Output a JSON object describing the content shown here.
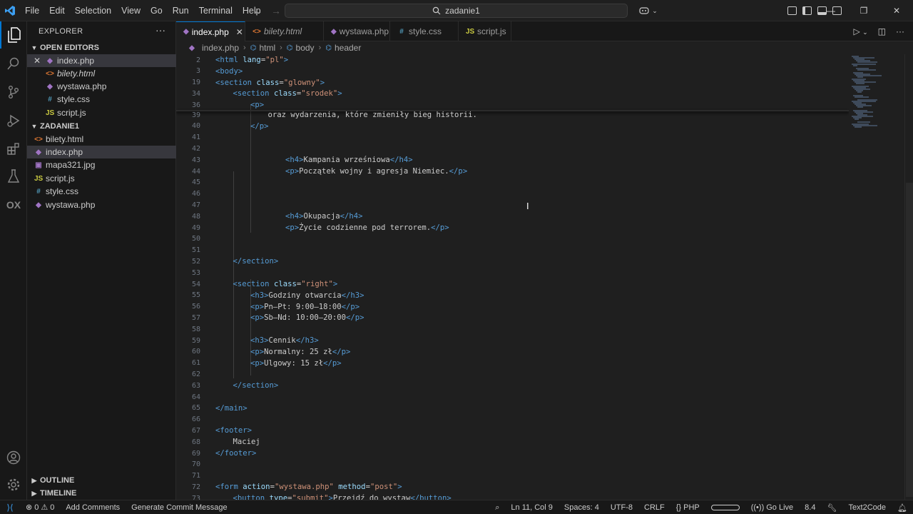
{
  "titlebar": {
    "menu": [
      "File",
      "Edit",
      "Selection",
      "View",
      "Go",
      "Run",
      "Terminal",
      "Help"
    ],
    "search_text": "zadanie1"
  },
  "sidebar": {
    "title": "EXPLORER",
    "open_editors_label": "OPEN EDITORS",
    "open_editors": [
      {
        "name": "index.php",
        "icon": "php-file-icon",
        "italic": false
      },
      {
        "name": "bilety.html",
        "icon": "html-file-icon",
        "italic": true
      },
      {
        "name": "wystawa.php",
        "icon": "php-file-icon",
        "italic": false
      },
      {
        "name": "style.css",
        "icon": "css-file-icon",
        "italic": false
      },
      {
        "name": "script.js",
        "icon": "js-file-icon",
        "italic": false
      }
    ],
    "folder_label": "ZADANIE1",
    "files": [
      {
        "name": "bilety.html",
        "icon": "html-file-icon"
      },
      {
        "name": "index.php",
        "icon": "php-file-icon"
      },
      {
        "name": "mapa321.jpg",
        "icon": "image-file-icon"
      },
      {
        "name": "script.js",
        "icon": "js-file-icon"
      },
      {
        "name": "style.css",
        "icon": "css-file-icon"
      },
      {
        "name": "wystawa.php",
        "icon": "php-file-icon"
      }
    ],
    "outline_label": "OUTLINE",
    "timeline_label": "TIMELINE"
  },
  "tabs": [
    {
      "label": "index.php",
      "icon": "php-file-icon",
      "active": true,
      "italic": false
    },
    {
      "label": "bilety.html",
      "icon": "html-file-icon",
      "active": false,
      "italic": true
    },
    {
      "label": "wystawa.php",
      "icon": "php-file-icon",
      "active": false,
      "italic": false
    },
    {
      "label": "style.css",
      "icon": "css-file-icon",
      "active": false,
      "italic": false
    },
    {
      "label": "script.js",
      "icon": "js-file-icon",
      "active": false,
      "italic": false
    }
  ],
  "breadcrumb": [
    "index.php",
    "html",
    "body",
    "header"
  ],
  "editor": {
    "sticky_lines": [
      {
        "num": "2",
        "indent": 0,
        "tokens": [
          [
            "brk",
            "<"
          ],
          [
            "tag",
            "html"
          ],
          [
            "txt",
            " "
          ],
          [
            "attr",
            "lang"
          ],
          [
            "txt",
            "="
          ],
          [
            "str",
            "\"pl\""
          ],
          [
            "brk",
            ">"
          ]
        ]
      },
      {
        "num": "3",
        "indent": 0,
        "tokens": [
          [
            "brk",
            "<"
          ],
          [
            "tag",
            "body"
          ],
          [
            "brk",
            ">"
          ]
        ]
      },
      {
        "num": "19",
        "indent": 0,
        "tokens": [
          [
            "brk",
            "<"
          ],
          [
            "tag",
            "section"
          ],
          [
            "txt",
            " "
          ],
          [
            "attr",
            "class"
          ],
          [
            "txt",
            "="
          ],
          [
            "str",
            "\"glowny\""
          ],
          [
            "brk",
            ">"
          ]
        ]
      },
      {
        "num": "34",
        "indent": 1,
        "tokens": [
          [
            "brk",
            "<"
          ],
          [
            "tag",
            "section"
          ],
          [
            "txt",
            " "
          ],
          [
            "attr",
            "class"
          ],
          [
            "txt",
            "="
          ],
          [
            "str",
            "\"srodek\""
          ],
          [
            "brk",
            ">"
          ]
        ]
      },
      {
        "num": "36",
        "indent": 2,
        "tokens": [
          [
            "brk",
            "<"
          ],
          [
            "tag",
            "p"
          ],
          [
            "brk",
            ">"
          ]
        ]
      }
    ],
    "lines": [
      {
        "num": "39",
        "indent": 3,
        "tokens": [
          [
            "txt",
            "oraz wydarzenia, które zmieniły bieg historii."
          ]
        ]
      },
      {
        "num": "40",
        "indent": 2,
        "tokens": [
          [
            "brk",
            "</"
          ],
          [
            "tag",
            "p"
          ],
          [
            "brk",
            ">"
          ]
        ]
      },
      {
        "num": "41",
        "indent": 0,
        "tokens": []
      },
      {
        "num": "42",
        "indent": 0,
        "tokens": []
      },
      {
        "num": "43",
        "indent": 4,
        "tokens": [
          [
            "brk",
            "<"
          ],
          [
            "tag",
            "h4"
          ],
          [
            "brk",
            ">"
          ],
          [
            "txt",
            "Kampania wrześniowa"
          ],
          [
            "brk",
            "</"
          ],
          [
            "tag",
            "h4"
          ],
          [
            "brk",
            ">"
          ]
        ]
      },
      {
        "num": "44",
        "indent": 4,
        "tokens": [
          [
            "brk",
            "<"
          ],
          [
            "tag",
            "p"
          ],
          [
            "brk",
            ">"
          ],
          [
            "txt",
            "Początek wojny i agresja Niemiec."
          ],
          [
            "brk",
            "</"
          ],
          [
            "tag",
            "p"
          ],
          [
            "brk",
            ">"
          ]
        ]
      },
      {
        "num": "45",
        "indent": 0,
        "tokens": []
      },
      {
        "num": "46",
        "indent": 0,
        "tokens": []
      },
      {
        "num": "47",
        "indent": 0,
        "tokens": []
      },
      {
        "num": "48",
        "indent": 4,
        "tokens": [
          [
            "brk",
            "<"
          ],
          [
            "tag",
            "h4"
          ],
          [
            "brk",
            ">"
          ],
          [
            "txt",
            "Okupacja"
          ],
          [
            "brk",
            "</"
          ],
          [
            "tag",
            "h4"
          ],
          [
            "brk",
            ">"
          ]
        ]
      },
      {
        "num": "49",
        "indent": 4,
        "tokens": [
          [
            "brk",
            "<"
          ],
          [
            "tag",
            "p"
          ],
          [
            "brk",
            ">"
          ],
          [
            "txt",
            "Życie codzienne pod terrorem."
          ],
          [
            "brk",
            "</"
          ],
          [
            "tag",
            "p"
          ],
          [
            "brk",
            ">"
          ]
        ]
      },
      {
        "num": "50",
        "indent": 0,
        "tokens": []
      },
      {
        "num": "51",
        "indent": 0,
        "tokens": []
      },
      {
        "num": "52",
        "indent": 1,
        "tokens": [
          [
            "brk",
            "</"
          ],
          [
            "tag",
            "section"
          ],
          [
            "brk",
            ">"
          ]
        ]
      },
      {
        "num": "53",
        "indent": 0,
        "tokens": []
      },
      {
        "num": "54",
        "indent": 1,
        "tokens": [
          [
            "brk",
            "<"
          ],
          [
            "tag",
            "section"
          ],
          [
            "txt",
            " "
          ],
          [
            "attr",
            "class"
          ],
          [
            "txt",
            "="
          ],
          [
            "str",
            "\"right\""
          ],
          [
            "brk",
            ">"
          ]
        ]
      },
      {
        "num": "55",
        "indent": 2,
        "tokens": [
          [
            "brk",
            "<"
          ],
          [
            "tag",
            "h3"
          ],
          [
            "brk",
            ">"
          ],
          [
            "txt",
            "Godziny otwarcia"
          ],
          [
            "brk",
            "</"
          ],
          [
            "tag",
            "h3"
          ],
          [
            "brk",
            ">"
          ]
        ]
      },
      {
        "num": "56",
        "indent": 2,
        "tokens": [
          [
            "brk",
            "<"
          ],
          [
            "tag",
            "p"
          ],
          [
            "brk",
            ">"
          ],
          [
            "txt",
            "Pn–Pt: 9:00–18:00"
          ],
          [
            "brk",
            "</"
          ],
          [
            "tag",
            "p"
          ],
          [
            "brk",
            ">"
          ]
        ]
      },
      {
        "num": "57",
        "indent": 2,
        "tokens": [
          [
            "brk",
            "<"
          ],
          [
            "tag",
            "p"
          ],
          [
            "brk",
            ">"
          ],
          [
            "txt",
            "Sb–Nd: 10:00–20:00"
          ],
          [
            "brk",
            "</"
          ],
          [
            "tag",
            "p"
          ],
          [
            "brk",
            ">"
          ]
        ]
      },
      {
        "num": "58",
        "indent": 0,
        "tokens": []
      },
      {
        "num": "59",
        "indent": 2,
        "tokens": [
          [
            "brk",
            "<"
          ],
          [
            "tag",
            "h3"
          ],
          [
            "brk",
            ">"
          ],
          [
            "txt",
            "Cennik"
          ],
          [
            "brk",
            "</"
          ],
          [
            "tag",
            "h3"
          ],
          [
            "brk",
            ">"
          ]
        ]
      },
      {
        "num": "60",
        "indent": 2,
        "tokens": [
          [
            "brk",
            "<"
          ],
          [
            "tag",
            "p"
          ],
          [
            "brk",
            ">"
          ],
          [
            "txt",
            "Normalny: 25 zł"
          ],
          [
            "brk",
            "</"
          ],
          [
            "tag",
            "p"
          ],
          [
            "brk",
            ">"
          ]
        ]
      },
      {
        "num": "61",
        "indent": 2,
        "tokens": [
          [
            "brk",
            "<"
          ],
          [
            "tag",
            "p"
          ],
          [
            "brk",
            ">"
          ],
          [
            "txt",
            "Ulgowy: 15 zł"
          ],
          [
            "brk",
            "</"
          ],
          [
            "tag",
            "p"
          ],
          [
            "brk",
            ">"
          ]
        ]
      },
      {
        "num": "62",
        "indent": 0,
        "tokens": []
      },
      {
        "num": "63",
        "indent": 1,
        "tokens": [
          [
            "brk",
            "</"
          ],
          [
            "tag",
            "section"
          ],
          [
            "brk",
            ">"
          ]
        ]
      },
      {
        "num": "64",
        "indent": 0,
        "tokens": []
      },
      {
        "num": "65",
        "indent": 0,
        "tokens": [
          [
            "brk",
            "</"
          ],
          [
            "tag",
            "main"
          ],
          [
            "brk",
            ">"
          ]
        ]
      },
      {
        "num": "66",
        "indent": 0,
        "tokens": []
      },
      {
        "num": "67",
        "indent": 0,
        "tokens": [
          [
            "brk",
            "<"
          ],
          [
            "tag",
            "footer"
          ],
          [
            "brk",
            ">"
          ]
        ]
      },
      {
        "num": "68",
        "indent": 1,
        "tokens": [
          [
            "txt",
            "Maciej"
          ]
        ]
      },
      {
        "num": "69",
        "indent": 0,
        "tokens": [
          [
            "brk",
            "</"
          ],
          [
            "tag",
            "footer"
          ],
          [
            "brk",
            ">"
          ]
        ]
      },
      {
        "num": "70",
        "indent": 0,
        "tokens": []
      },
      {
        "num": "71",
        "indent": 0,
        "tokens": []
      },
      {
        "num": "72",
        "indent": 0,
        "tokens": [
          [
            "brk",
            "<"
          ],
          [
            "tag",
            "form"
          ],
          [
            "txt",
            " "
          ],
          [
            "attr",
            "action"
          ],
          [
            "txt",
            "="
          ],
          [
            "str",
            "\"wystawa.php\""
          ],
          [
            "txt",
            " "
          ],
          [
            "attr",
            "method"
          ],
          [
            "txt",
            "="
          ],
          [
            "str",
            "\"post\""
          ],
          [
            "brk",
            ">"
          ]
        ]
      },
      {
        "num": "73",
        "indent": 1,
        "tokens": [
          [
            "brk",
            "<"
          ],
          [
            "tag",
            "button"
          ],
          [
            "txt",
            " "
          ],
          [
            "attr",
            "type"
          ],
          [
            "txt",
            "="
          ],
          [
            "str",
            "\"submit\""
          ],
          [
            "brk",
            ">"
          ],
          [
            "txt",
            "Przejdź do wystaw"
          ],
          [
            "brk",
            "</"
          ],
          [
            "tag",
            "button"
          ],
          [
            "brk",
            ">"
          ]
        ]
      }
    ]
  },
  "statusbar": {
    "errors": "0",
    "warnings": "0",
    "add_comments": "Add Comments",
    "generate_commit": "Generate Commit Message",
    "position": "Ln 11, Col 9",
    "spaces": "Spaces: 4",
    "encoding": "UTF-8",
    "eol": "CRLF",
    "language": "PHP",
    "go_live": "Go Live",
    "version": "8.4",
    "text2code": "Text2Code"
  },
  "colors": {
    "accent": "#0078d4",
    "tag": "#569cd6",
    "attr": "#9cdcfe",
    "string": "#ce9178",
    "php_icon": "#a074c4",
    "html_icon": "#e37933",
    "css_icon": "#519aba",
    "js_icon": "#cbcb41"
  }
}
